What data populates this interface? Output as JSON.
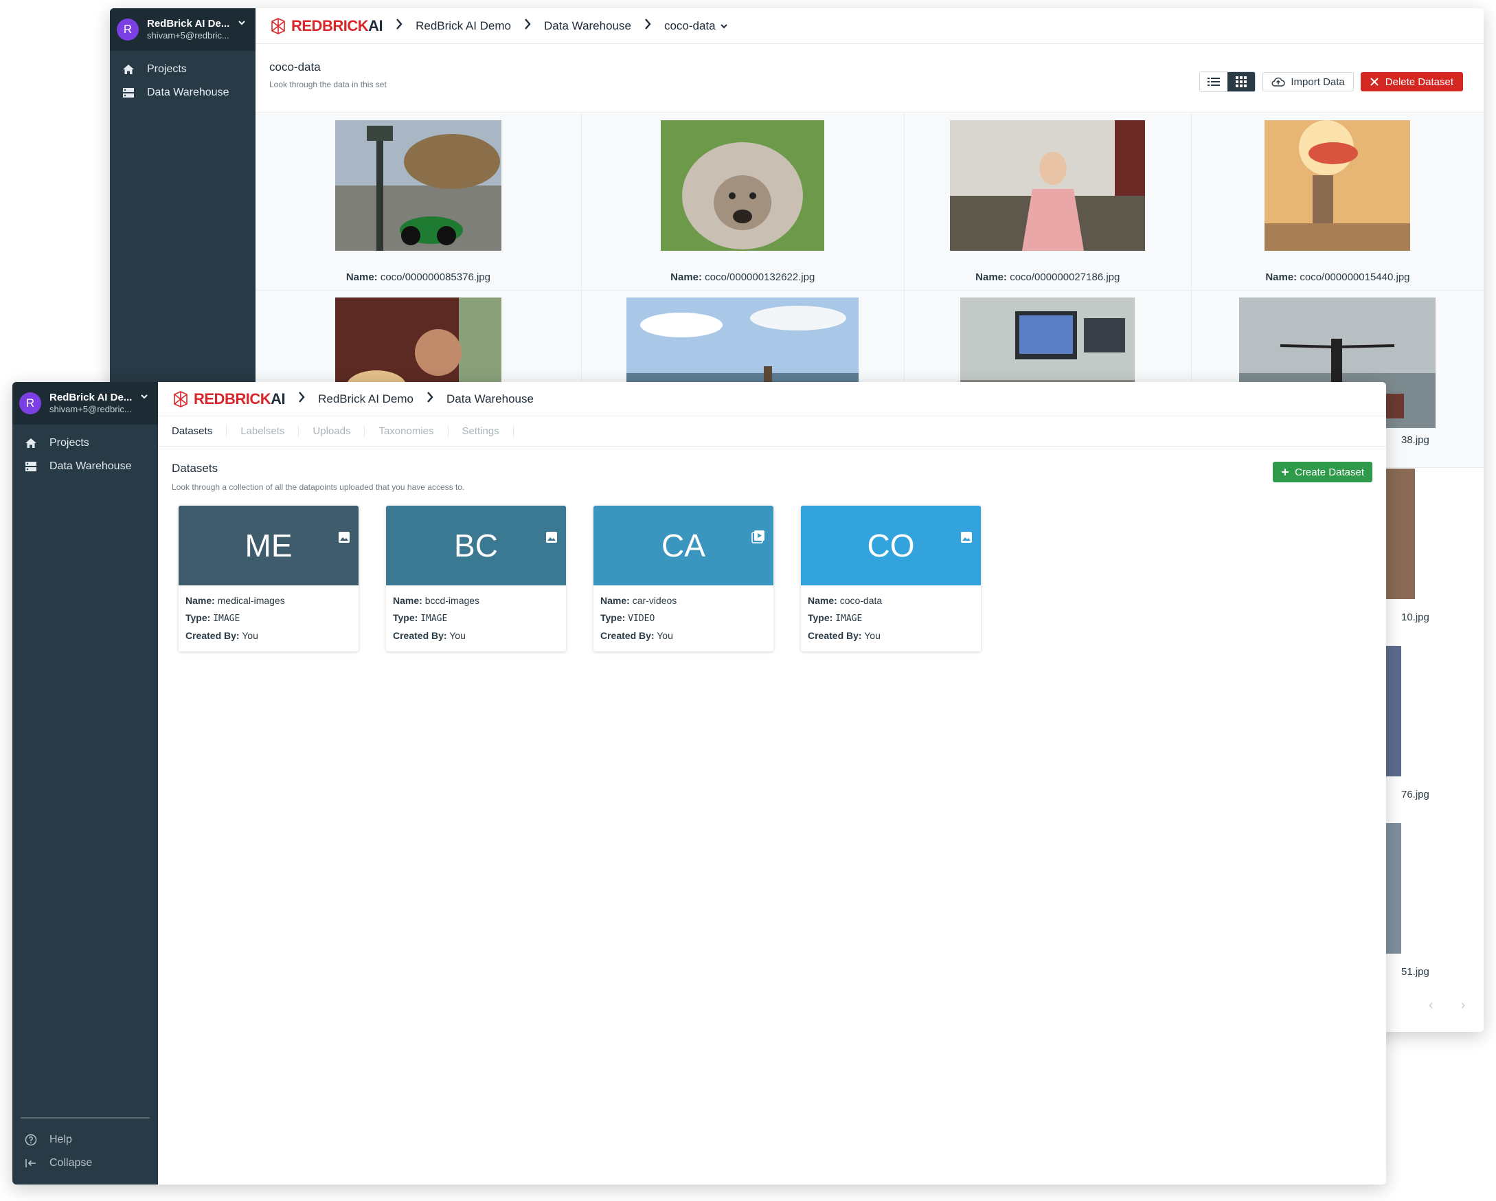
{
  "workspace": {
    "initial": "R",
    "name": "RedBrick AI De...",
    "email": "shivam+5@redbric..."
  },
  "logo": {
    "brand": "REDBRICK",
    "suffix": "AI"
  },
  "sidebar": {
    "items": [
      {
        "label": "Projects",
        "icon": "home-icon"
      },
      {
        "label": "Data Warehouse",
        "icon": "server-icon"
      }
    ],
    "bottom": [
      {
        "label": "Help",
        "icon": "help-icon"
      },
      {
        "label": "Collapse",
        "icon": "collapse-icon"
      }
    ]
  },
  "back": {
    "breadcrumb": [
      "RedBrick AI Demo",
      "Data Warehouse",
      "coco-data"
    ],
    "title": "coco-data",
    "subtitle": "Look through the data in this set",
    "import_label": "Import Data",
    "delete_label": "Delete Dataset",
    "name_prefix": "Name:",
    "row1": [
      "coco/000000085376.jpg",
      "coco/000000132622.jpg",
      "coco/000000027186.jpg",
      "coco/000000015440.jpg"
    ],
    "peek_captions": [
      "38.jpg",
      "10.jpg",
      "76.jpg",
      "51.jpg"
    ]
  },
  "front": {
    "breadcrumb": [
      "RedBrick AI Demo",
      "Data Warehouse"
    ],
    "tabs": [
      "Datasets",
      "Labelsets",
      "Uploads",
      "Taxonomies",
      "Settings"
    ],
    "title": "Datasets",
    "subtitle": "Look through a collection of all the datapoints uploaded that you have access to.",
    "create_label": "Create Dataset",
    "labels": {
      "name": "Name:",
      "type": "Type:",
      "created": "Created By:"
    },
    "cards": [
      {
        "abbr": "ME",
        "name": "medical-images",
        "type": "IMAGE",
        "created_by": "You",
        "color": "#3f5c6c"
      },
      {
        "abbr": "BC",
        "name": "bccd-images",
        "type": "IMAGE",
        "created_by": "You",
        "color": "#3b7891"
      },
      {
        "abbr": "CA",
        "name": "car-videos",
        "type": "VIDEO",
        "created_by": "You",
        "color": "#3a95bf"
      },
      {
        "abbr": "CO",
        "name": "coco-data",
        "type": "IMAGE",
        "created_by": "You",
        "color": "#32a3dd"
      }
    ]
  }
}
